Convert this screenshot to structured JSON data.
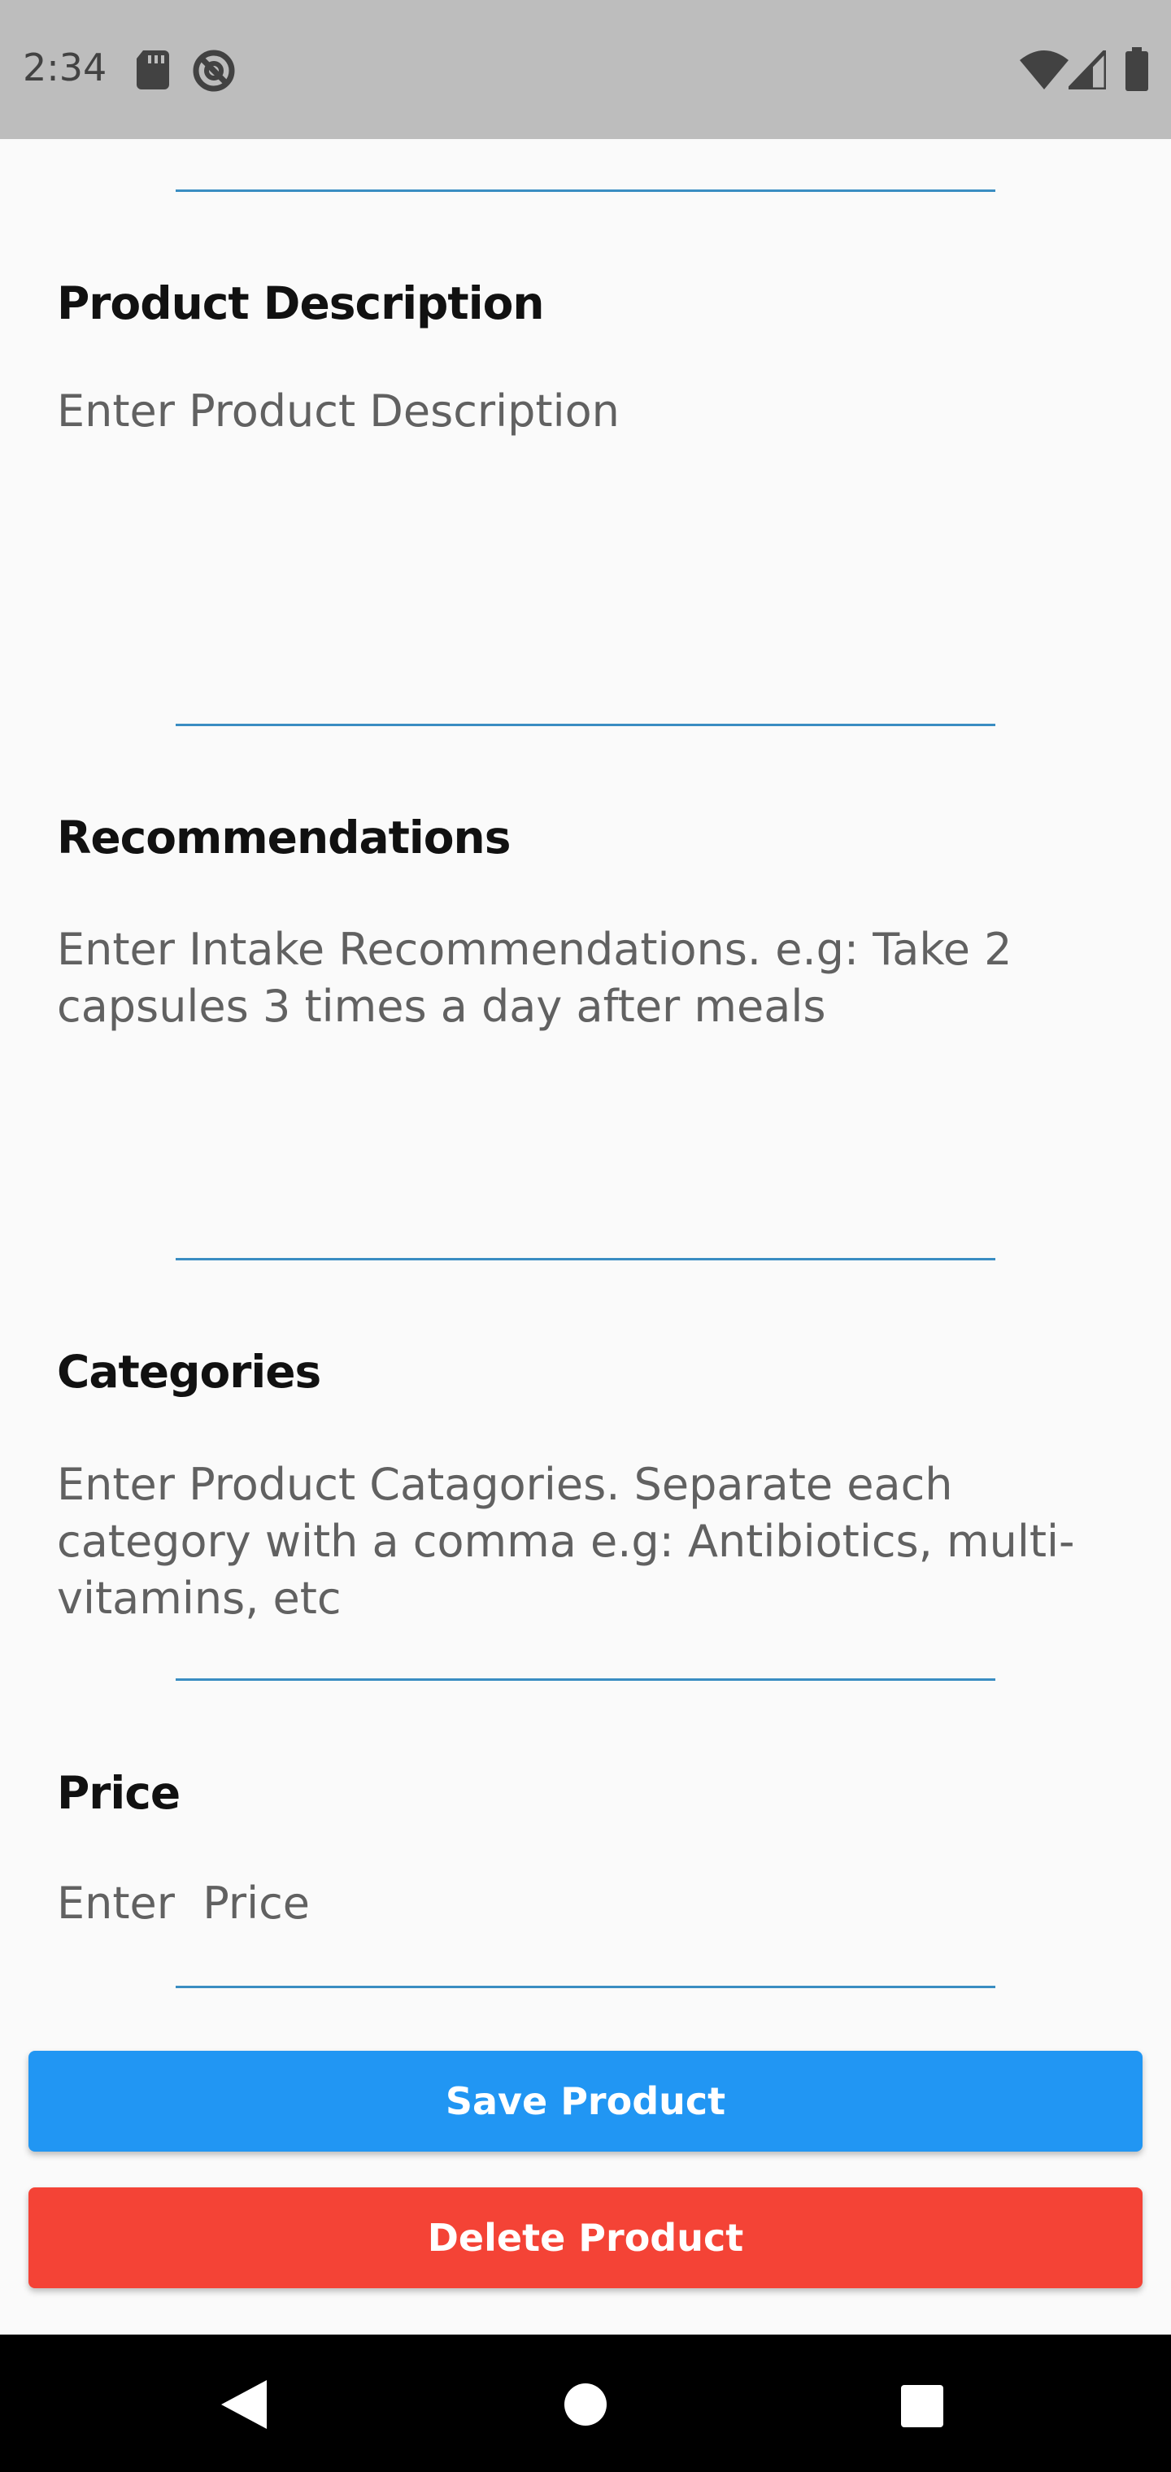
{
  "status_bar": {
    "time": "2:34",
    "icons": [
      "sd-card-icon",
      "no-sync-icon",
      "wifi-icon",
      "cell-signal-icon",
      "battery-icon"
    ]
  },
  "form": {
    "description": {
      "label": "Product Description",
      "placeholder": "Enter Product Description"
    },
    "recommendations": {
      "label": "Recommendations",
      "placeholder": "Enter Intake Recommendations. e.g: Take 2 capsules 3 times a day after meals"
    },
    "categories": {
      "label": "Categories",
      "placeholder": "Enter Product Catagories. Separate each category with a comma e.g: Antibiotics, multi-vitamins, etc"
    },
    "price": {
      "label": "Price",
      "placeholder": "Enter  Price"
    }
  },
  "actions": {
    "save_label": "Save Product",
    "delete_label": "Delete Product"
  },
  "colors": {
    "status_bar": "#BDBDBD",
    "divider": "#3A8DC2",
    "save": "#2196F3",
    "delete": "#F44336",
    "nav_bar": "#000000"
  },
  "nav_bar": {
    "icons": [
      "back-icon",
      "home-icon",
      "recents-icon"
    ]
  }
}
